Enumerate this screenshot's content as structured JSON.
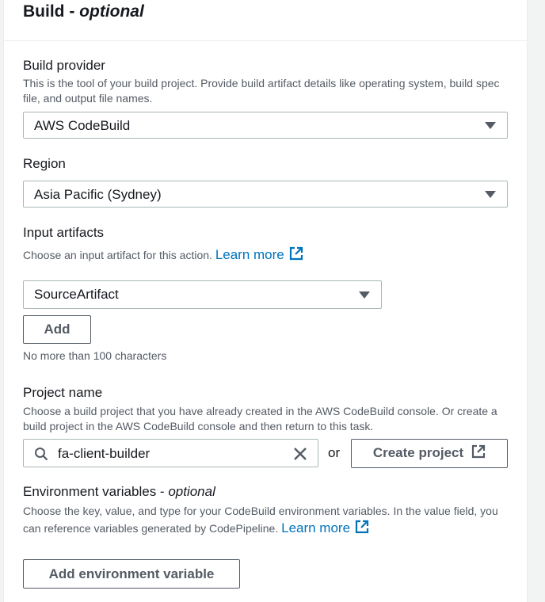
{
  "section": {
    "title": "Build",
    "title_suffix": "optional"
  },
  "build_provider": {
    "label": "Build provider",
    "description": "This is the tool of your build project. Provide build artifact details like operating system, build spec file, and output file names.",
    "selected": "AWS CodeBuild"
  },
  "region": {
    "label": "Region",
    "selected": "Asia Pacific (Sydney)"
  },
  "input_artifacts": {
    "label": "Input artifacts",
    "description": "Choose an input artifact for this action.",
    "learn_more": "Learn more",
    "selected": "SourceArtifact",
    "add_label": "Add",
    "constraint": "No more than 100 characters"
  },
  "project_name": {
    "label": "Project name",
    "description": "Choose a build project that you have already created in the AWS CodeBuild console. Or create a build project in the AWS CodeBuild console and then return to this task.",
    "value": "fa-client-builder",
    "or_text": "or",
    "create_label": "Create project"
  },
  "env_vars": {
    "label": "Environment variables",
    "label_suffix": "optional",
    "description": "Choose the key, value, and type for your CodeBuild environment variables. In the value field, you can reference variables generated by CodePipeline.",
    "learn_more": "Learn more",
    "add_label": "Add environment variable"
  },
  "colors": {
    "link": "#0073bb",
    "text": "#16191f",
    "secondary_text": "#545b64",
    "border": "#aab7b8"
  }
}
